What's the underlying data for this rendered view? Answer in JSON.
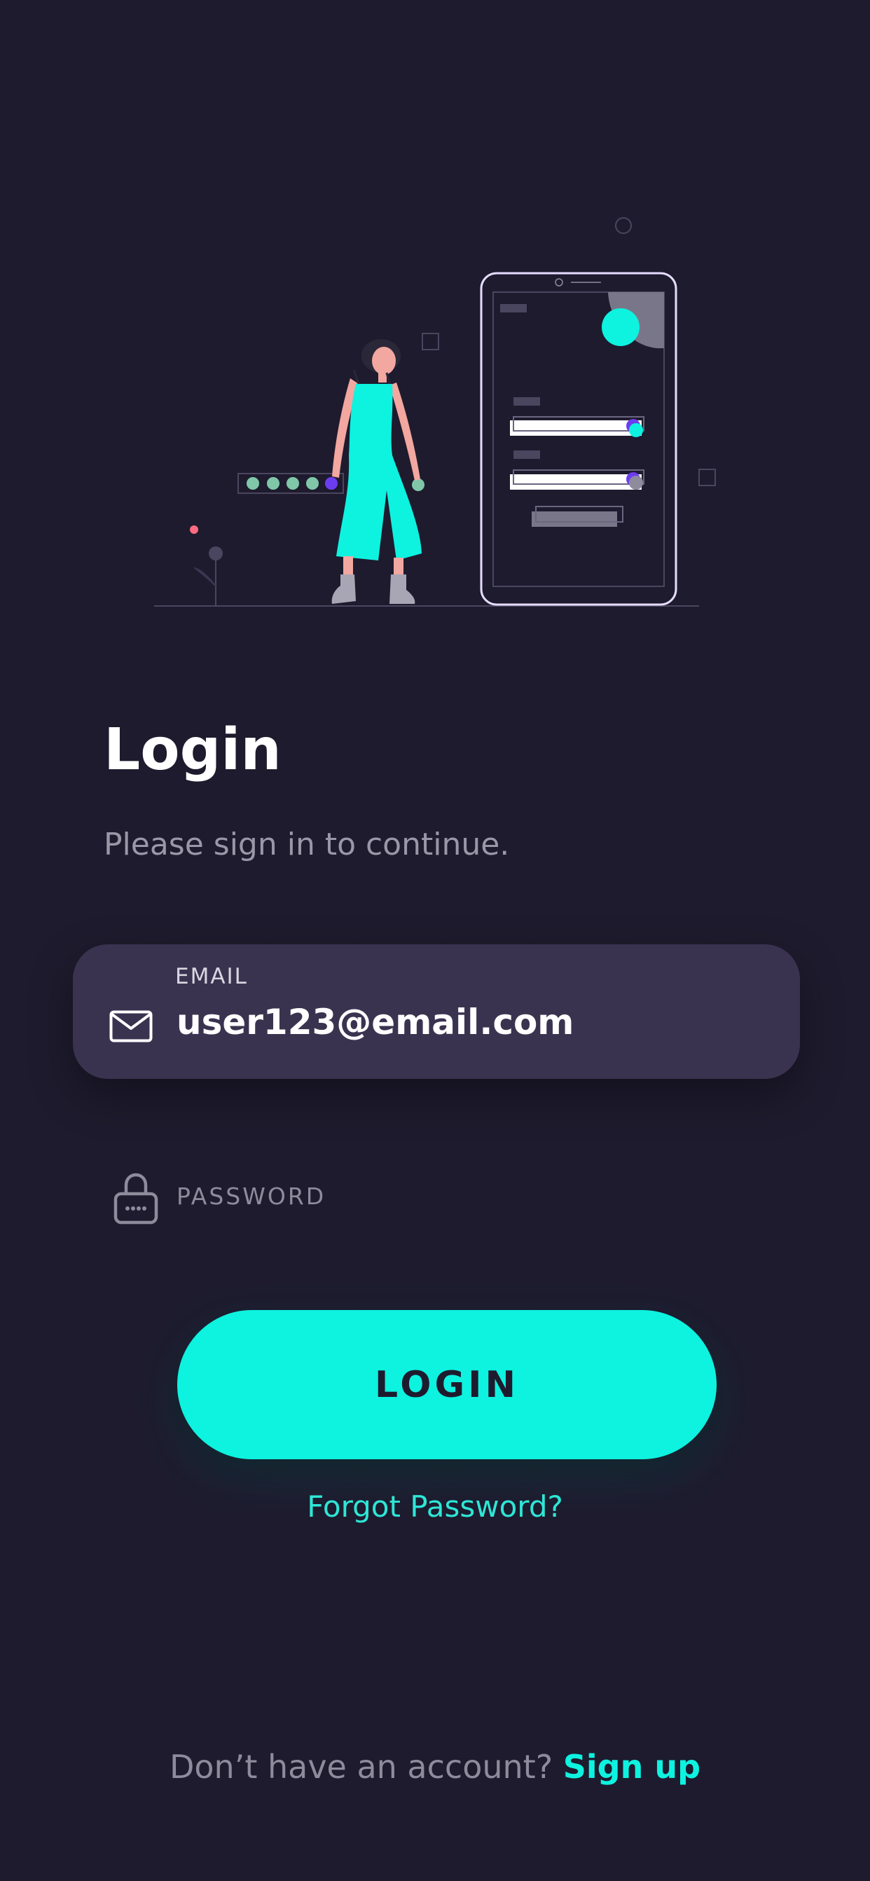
{
  "header": {
    "title": "Login",
    "subtitle": "Please sign in to continue."
  },
  "email": {
    "label": "EMAIL",
    "value": "user123@email.com",
    "icon": "mail-icon"
  },
  "password": {
    "placeholder": "PASSWORD",
    "icon": "lock-icon"
  },
  "actions": {
    "login_label": "LOGIN",
    "forgot_label": "Forgot Password?"
  },
  "footer": {
    "prompt": "Don’t have an account?",
    "signup_label": "Sign up"
  },
  "colors": {
    "background": "#1e1b2e",
    "accent": "#0ef2e0",
    "field": "#3a3350",
    "muted_text": "#8e8b9c"
  }
}
